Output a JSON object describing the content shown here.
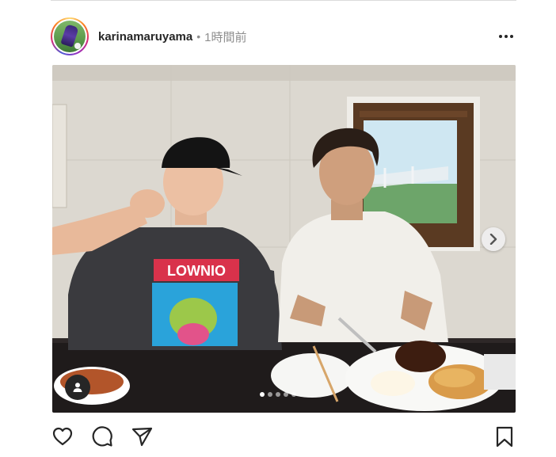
{
  "post": {
    "username": "karinamaruyama",
    "separator": "•",
    "time": "1時間前"
  },
  "icons": {
    "more": "more-options-icon",
    "next": "chevron-right-icon",
    "tag": "person-tag-icon",
    "like": "heart-icon",
    "comment": "comment-icon",
    "share": "send-icon",
    "save": "bookmark-icon"
  },
  "carousel": {
    "count": 5,
    "active_index": 0
  },
  "colors": {
    "text": "#262626",
    "muted": "#8e8e8e",
    "divider": "#dbdbdb"
  }
}
